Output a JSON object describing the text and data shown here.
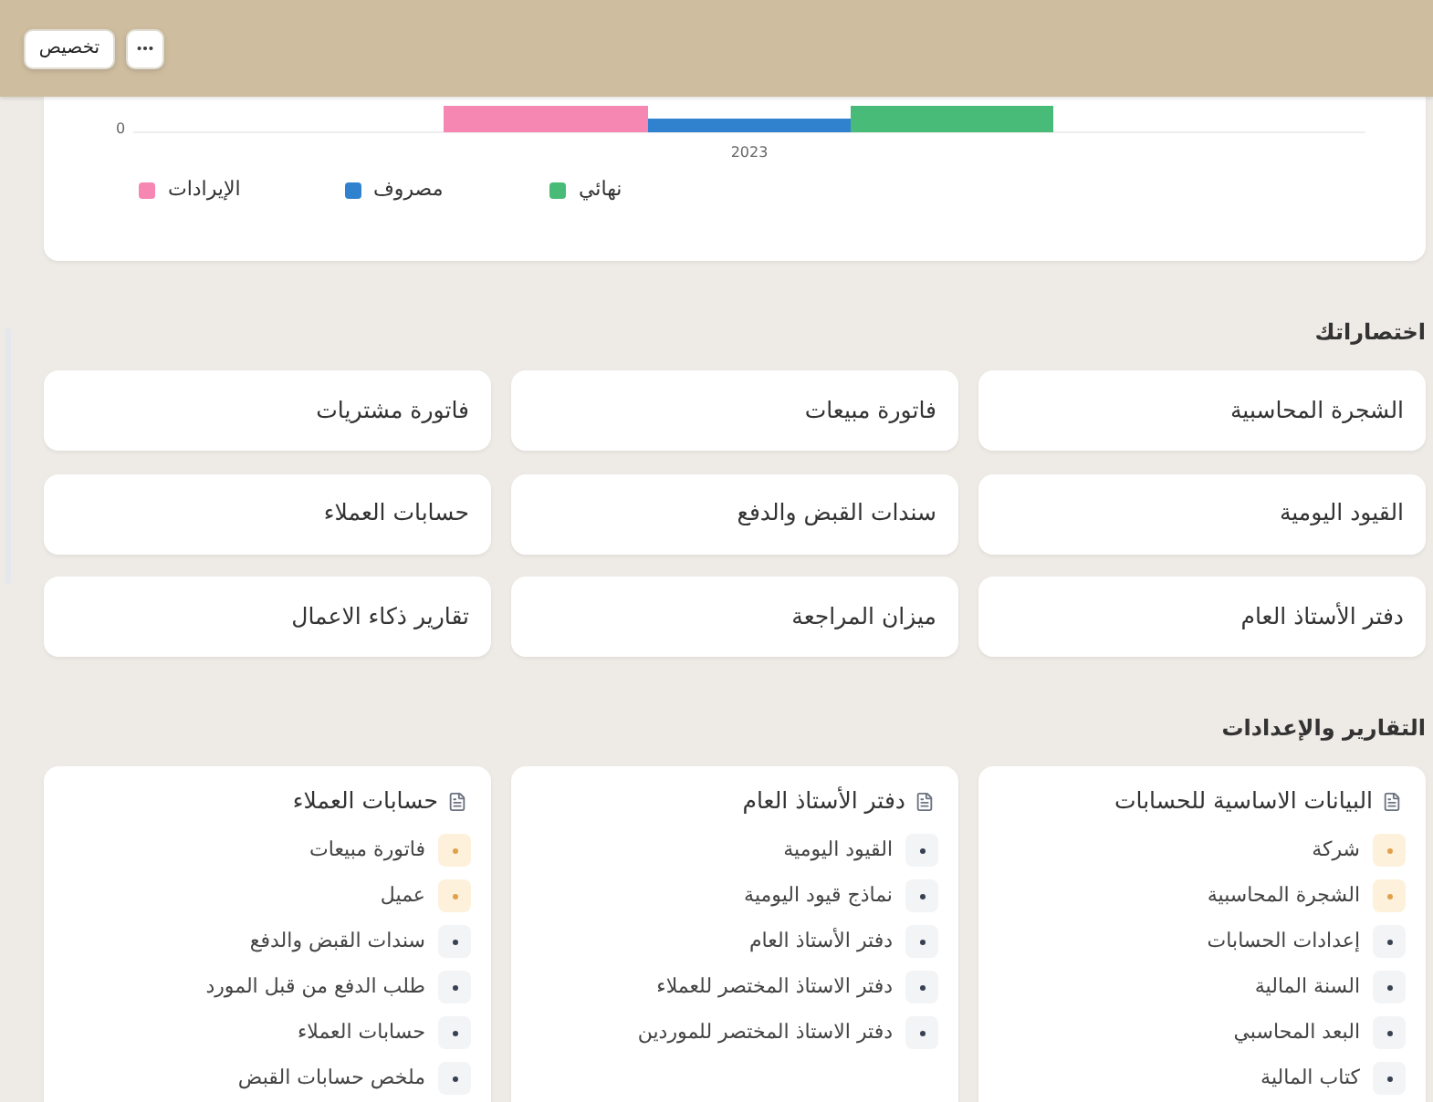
{
  "toolbar": {
    "customize_button": "تخصيص"
  },
  "chart": {
    "y_tick_label": "0",
    "category_label": "2023",
    "legend": [
      {
        "label": "نهائي",
        "color": "#48bb78"
      },
      {
        "label": "مصروف",
        "color": "#3182ce"
      },
      {
        "label": "الإيرادات",
        "color": "#f687b3"
      }
    ]
  },
  "shortcuts": {
    "title": "اختصاراتك",
    "items": [
      "الشجرة المحاسبية",
      "فاتورة مبيعات",
      "فاتورة مشتريات",
      "القيود اليومية",
      "سندات القبض والدفع",
      "حسابات العملاء",
      "دفتر الأستاذ العام",
      "ميزان المراجعة",
      "تقارير ذكاء الاعمال"
    ]
  },
  "reports": {
    "title": "التقارير والإعدادات",
    "groups": [
      {
        "title": "البيانات الاساسية للحسابات",
        "items": [
          {
            "label": "شركة",
            "highlighted": true
          },
          {
            "label": "الشجرة المحاسبية",
            "highlighted": true
          },
          {
            "label": "إعدادات الحسابات",
            "highlighted": false
          },
          {
            "label": "السنة المالية",
            "highlighted": false
          },
          {
            "label": "البعد المحاسبي",
            "highlighted": false
          },
          {
            "label": "كتاب المالية",
            "highlighted": false
          }
        ]
      },
      {
        "title": "دفتر الأستاذ العام",
        "items": [
          {
            "label": "القيود اليومية",
            "highlighted": false
          },
          {
            "label": "نماذج قيود اليومية",
            "highlighted": false
          },
          {
            "label": "دفتر الأستاذ العام",
            "highlighted": false
          },
          {
            "label": "دفتر الاستاذ المختصر للعملاء",
            "highlighted": false
          },
          {
            "label": "دفتر الاستاذ المختصر للموردين",
            "highlighted": false
          }
        ]
      },
      {
        "title": "حسابات العملاء",
        "items": [
          {
            "label": "فاتورة مبيعات",
            "highlighted": true
          },
          {
            "label": "عميل",
            "highlighted": true
          },
          {
            "label": "سندات القبض والدفع",
            "highlighted": false
          },
          {
            "label": "طلب الدفع من قبل المورد",
            "highlighted": false
          },
          {
            "label": "حسابات العملاء",
            "highlighted": false
          },
          {
            "label": "ملخص حسابات القبض",
            "highlighted": false
          }
        ]
      }
    ]
  }
}
